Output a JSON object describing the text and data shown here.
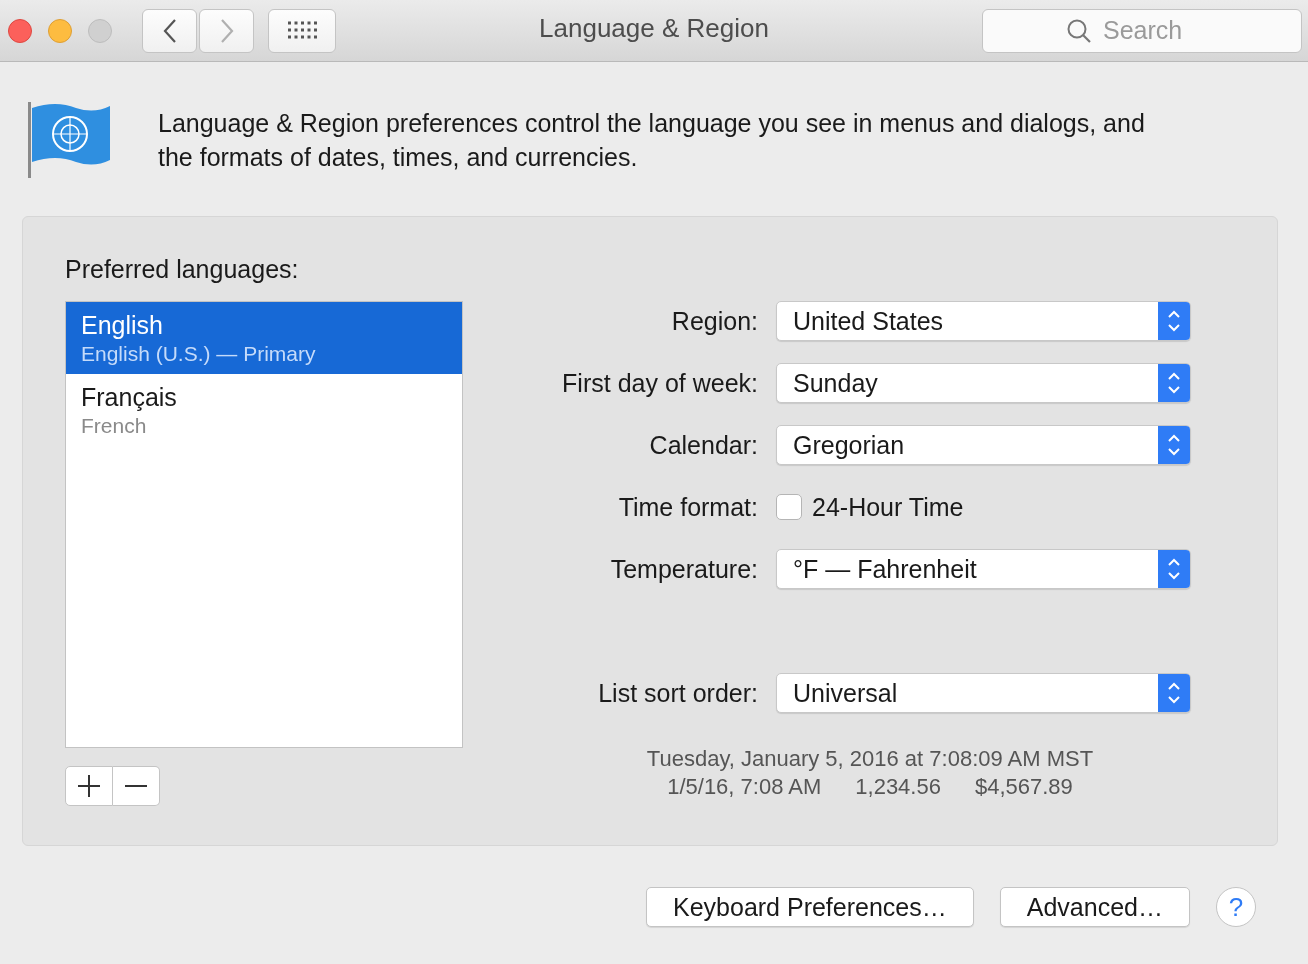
{
  "window": {
    "title": "Language & Region",
    "search_placeholder": "Search"
  },
  "intro": "Language & Region preferences control the language you see in menus and dialogs, and the formats of dates, times, and currencies.",
  "languages_label": "Preferred languages:",
  "languages": [
    {
      "name": "English",
      "subtitle": "English (U.S.) — Primary",
      "selected": true
    },
    {
      "name": "Français",
      "subtitle": "French",
      "selected": false
    }
  ],
  "settings": [
    {
      "kind": "popup",
      "label": "Region:",
      "value": "United States"
    },
    {
      "kind": "popup",
      "label": "First day of week:",
      "value": "Sunday"
    },
    {
      "kind": "popup",
      "label": "Calendar:",
      "value": "Gregorian"
    },
    {
      "kind": "checkbox",
      "label": "Time format:",
      "value": "24-Hour Time",
      "checked": false
    },
    {
      "kind": "popup",
      "label": "Temperature:",
      "value": "°F — Fahrenheit"
    }
  ],
  "sort_order": {
    "label": "List sort order:",
    "value": "Universal"
  },
  "sample": {
    "long_date": "Tuesday, January 5, 2016 at 7:08:09 AM MST",
    "short_formats": [
      "1/5/16, 7:08 AM",
      "1,234.56",
      "$4,567.89"
    ]
  },
  "buttons": [
    "Keyboard Preferences…",
    "Advanced…"
  ],
  "help": "?"
}
